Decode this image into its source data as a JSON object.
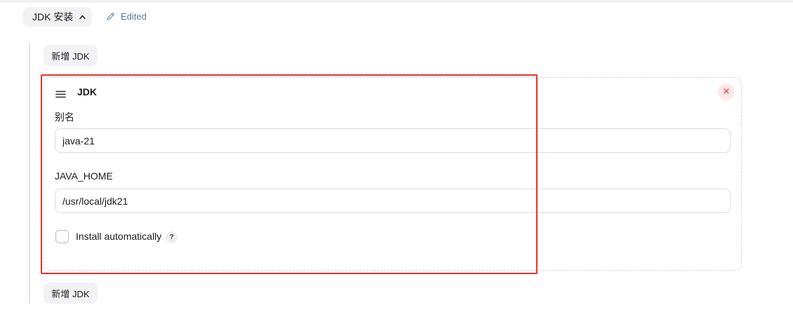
{
  "section_toggle": {
    "label": "JDK 安装",
    "icon": "chevron-up-icon"
  },
  "edited": {
    "label": "Edited",
    "icon": "pencil-icon"
  },
  "add_button_top": {
    "label": "新增 JDK"
  },
  "jdk_card": {
    "title": "JDK",
    "drag_icon": "drag-handle-icon",
    "close_icon": "close-icon",
    "fields": [
      {
        "label": "别名",
        "value": "java-21"
      },
      {
        "label": "JAVA_HOME",
        "value": "/usr/local/jdk21"
      }
    ],
    "install_automatically": {
      "label": "Install automatically",
      "checked": false,
      "help": "?"
    }
  },
  "add_button_bottom": {
    "label": "新增 JDK"
  },
  "colors": {
    "annotation_border": "#e5332a",
    "edited_text": "#5b7897",
    "close_button_bg": "#fde8ea",
    "close_icon": "#d9434a",
    "button_bg": "#f2f2f4"
  }
}
